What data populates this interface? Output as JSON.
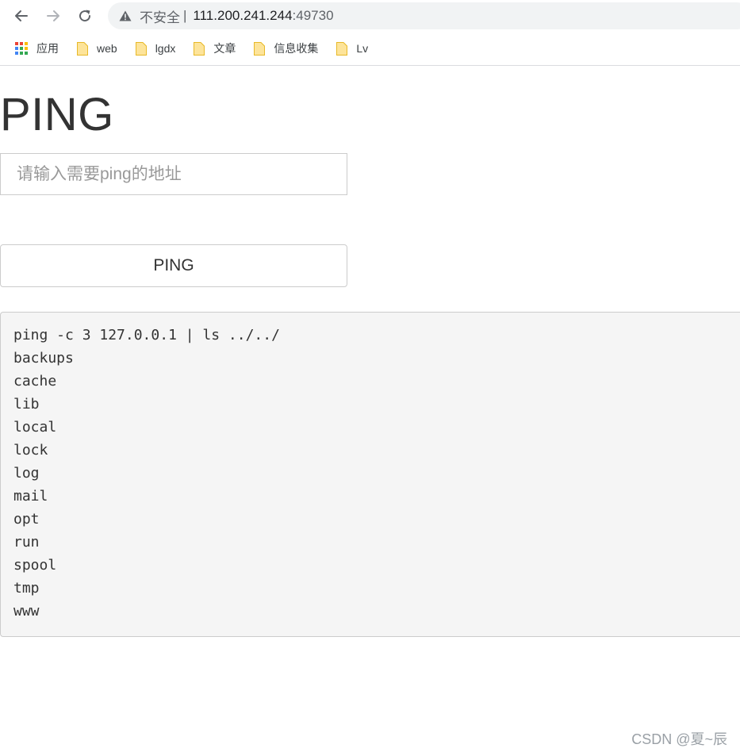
{
  "browser": {
    "security_label": "不安全",
    "separator": "|",
    "url_host": "111.200.241.244",
    "url_port": ":49730",
    "bookmarks": [
      {
        "label": "应用",
        "icon": "apps-grid-icon"
      },
      {
        "label": "web",
        "icon": "folder-icon"
      },
      {
        "label": "lgdx",
        "icon": "folder-icon"
      },
      {
        "label": "文章",
        "icon": "folder-icon"
      },
      {
        "label": "信息收集",
        "icon": "folder-icon"
      },
      {
        "label": "Lv",
        "icon": "folder-icon"
      }
    ]
  },
  "page": {
    "title": "PING",
    "input_placeholder": "请输入需要ping的地址",
    "input_value": "",
    "button_label": "PING",
    "output_lines": [
      "ping -c 3 127.0.0.1 | ls ../../",
      "backups",
      "cache",
      "lib",
      "local",
      "lock",
      "log",
      "mail",
      "opt",
      "run",
      "spool",
      "tmp",
      "www"
    ]
  },
  "watermark": "CSDN @夏~辰",
  "colors": {
    "folder_fill": "#fde49a",
    "folder_stroke": "#e8b928",
    "output_bg": "#f5f5f5",
    "border": "#cccccc"
  }
}
